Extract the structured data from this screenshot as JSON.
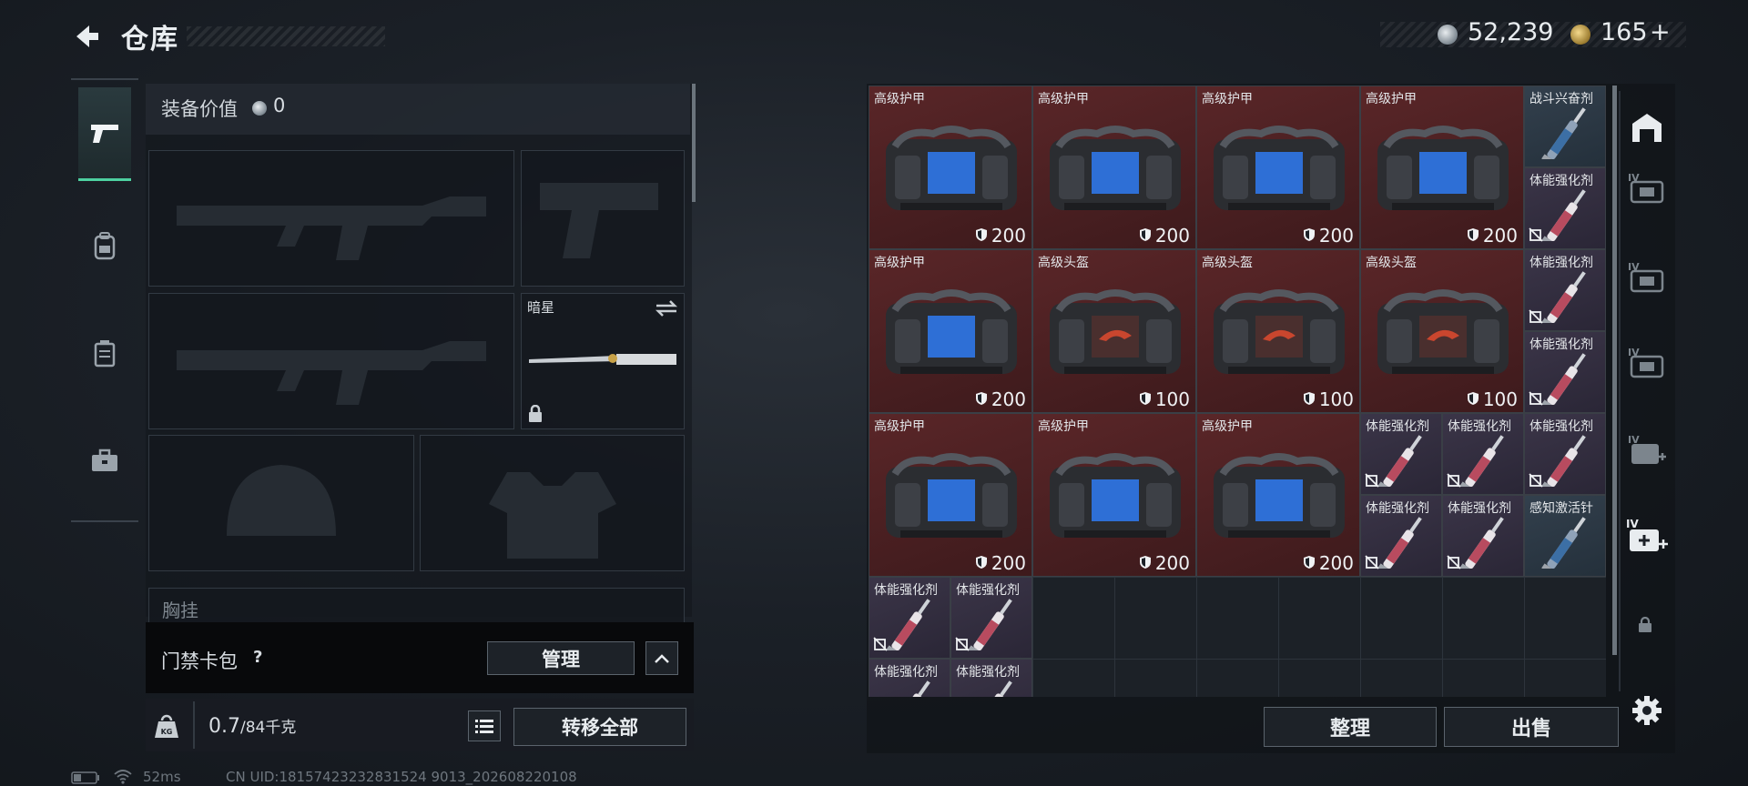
{
  "header": {
    "title": "仓库",
    "silver": "52,239",
    "gold": "165",
    "gold_plus": "+"
  },
  "equipment": {
    "value_label": "装备价值",
    "value": "0",
    "melee_name": "暗星",
    "chest_rig_label": "胸挂",
    "access_card_label": "门禁卡包",
    "help": "?",
    "manage_label": "管理",
    "weight_current": "0.7",
    "weight_max": "/84千克",
    "transfer_all_label": "转移全部"
  },
  "storage": {
    "items": [
      {
        "name": "高级护甲",
        "value": "200",
        "kind": "armor",
        "col": 0,
        "row": 0,
        "w": 2,
        "h": 2,
        "bg": "red"
      },
      {
        "name": "高级护甲",
        "value": "200",
        "kind": "armor",
        "col": 2,
        "row": 0,
        "w": 2,
        "h": 2,
        "bg": "red"
      },
      {
        "name": "高级护甲",
        "value": "200",
        "kind": "armor",
        "col": 4,
        "row": 0,
        "w": 2,
        "h": 2,
        "bg": "red"
      },
      {
        "name": "高级护甲",
        "value": "200",
        "kind": "armor",
        "col": 6,
        "row": 0,
        "w": 2,
        "h": 2,
        "bg": "red"
      },
      {
        "name": "战斗兴奋剂",
        "value": "",
        "kind": "syringe-blue",
        "col": 8,
        "row": 0,
        "w": 1,
        "h": 1,
        "bg": "blue"
      },
      {
        "name": "体能强化剂",
        "value": "",
        "kind": "syringe",
        "col": 8,
        "row": 1,
        "w": 1,
        "h": 1,
        "bg": "purple"
      },
      {
        "name": "高级护甲",
        "value": "200",
        "kind": "armor",
        "col": 0,
        "row": 2,
        "w": 2,
        "h": 2,
        "bg": "red"
      },
      {
        "name": "高级头盔",
        "value": "100",
        "kind": "helmet",
        "col": 2,
        "row": 2,
        "w": 2,
        "h": 2,
        "bg": "red"
      },
      {
        "name": "高级头盔",
        "value": "100",
        "kind": "helmet",
        "col": 4,
        "row": 2,
        "w": 2,
        "h": 2,
        "bg": "red"
      },
      {
        "name": "高级头盔",
        "value": "100",
        "kind": "helmet",
        "col": 6,
        "row": 2,
        "w": 2,
        "h": 2,
        "bg": "red"
      },
      {
        "name": "体能强化剂",
        "value": "",
        "kind": "syringe",
        "col": 8,
        "row": 2,
        "w": 1,
        "h": 1,
        "bg": "purple"
      },
      {
        "name": "体能强化剂",
        "value": "",
        "kind": "syringe",
        "col": 8,
        "row": 3,
        "w": 1,
        "h": 1,
        "bg": "purple"
      },
      {
        "name": "高级护甲",
        "value": "200",
        "kind": "armor",
        "col": 0,
        "row": 4,
        "w": 2,
        "h": 2,
        "bg": "red"
      },
      {
        "name": "高级护甲",
        "value": "200",
        "kind": "armor",
        "col": 2,
        "row": 4,
        "w": 2,
        "h": 2,
        "bg": "red"
      },
      {
        "name": "高级护甲",
        "value": "200",
        "kind": "armor",
        "col": 4,
        "row": 4,
        "w": 2,
        "h": 2,
        "bg": "red"
      },
      {
        "name": "体能强化剂",
        "value": "",
        "kind": "syringe",
        "col": 6,
        "row": 4,
        "w": 1,
        "h": 1,
        "bg": "purple"
      },
      {
        "name": "体能强化剂",
        "value": "",
        "kind": "syringe",
        "col": 7,
        "row": 4,
        "w": 1,
        "h": 1,
        "bg": "purple"
      },
      {
        "name": "体能强化剂",
        "value": "",
        "kind": "syringe",
        "col": 8,
        "row": 4,
        "w": 1,
        "h": 1,
        "bg": "purple"
      },
      {
        "name": "体能强化剂",
        "value": "",
        "kind": "syringe",
        "col": 6,
        "row": 5,
        "w": 1,
        "h": 1,
        "bg": "purple"
      },
      {
        "name": "体能强化剂",
        "value": "",
        "kind": "syringe",
        "col": 7,
        "row": 5,
        "w": 1,
        "h": 1,
        "bg": "purple"
      },
      {
        "name": "感知激活针",
        "value": "",
        "kind": "syringe-blue",
        "col": 8,
        "row": 5,
        "w": 1,
        "h": 1,
        "bg": "blue"
      },
      {
        "name": "体能强化剂",
        "value": "",
        "kind": "syringe",
        "col": 0,
        "row": 6,
        "w": 1,
        "h": 1,
        "bg": "purple"
      },
      {
        "name": "体能强化剂",
        "value": "",
        "kind": "syringe",
        "col": 1,
        "row": 6,
        "w": 1,
        "h": 1,
        "bg": "purple"
      },
      {
        "name": "体能强化剂",
        "value": "",
        "kind": "syringe",
        "col": 0,
        "row": 7,
        "w": 1,
        "h": 1,
        "bg": "purple"
      },
      {
        "name": "体能强化剂",
        "value": "",
        "kind": "syringe",
        "col": 1,
        "row": 7,
        "w": 1,
        "h": 1,
        "bg": "purple"
      }
    ],
    "sort_label": "整理",
    "sell_label": "出售"
  },
  "status": {
    "ping": "52ms",
    "uid": "CN UID:18157423232831524 9013_202608220108"
  }
}
